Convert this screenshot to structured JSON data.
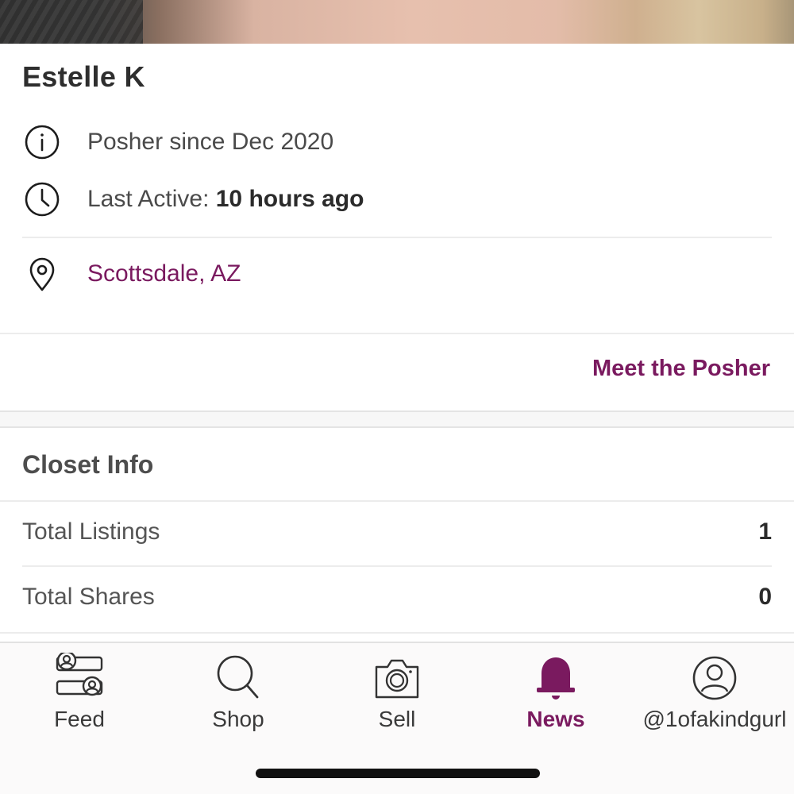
{
  "profile": {
    "name": "Estelle K",
    "posher_since": "Posher since Dec 2020",
    "last_active_label": "Last Active: ",
    "last_active_value": "10 hours ago",
    "location": "Scottsdale, AZ",
    "meet_link": "Meet the Posher"
  },
  "closet": {
    "title": "Closet Info",
    "stats": [
      {
        "label": "Total Listings",
        "value": "1"
      },
      {
        "label": "Total Shares",
        "value": "0"
      }
    ]
  },
  "tabbar": {
    "tabs": [
      {
        "label": "Feed",
        "icon": "feed-icon",
        "active": false
      },
      {
        "label": "Shop",
        "icon": "search-icon",
        "active": false
      },
      {
        "label": "Sell",
        "icon": "camera-icon",
        "active": false
      },
      {
        "label": "News",
        "icon": "bell-icon",
        "active": true
      },
      {
        "label": "@1ofakindgurl",
        "icon": "user-icon",
        "active": false
      }
    ]
  },
  "colors": {
    "accent": "#7a1a5f",
    "text": "#2b2b2b",
    "divider": "#ececec"
  }
}
